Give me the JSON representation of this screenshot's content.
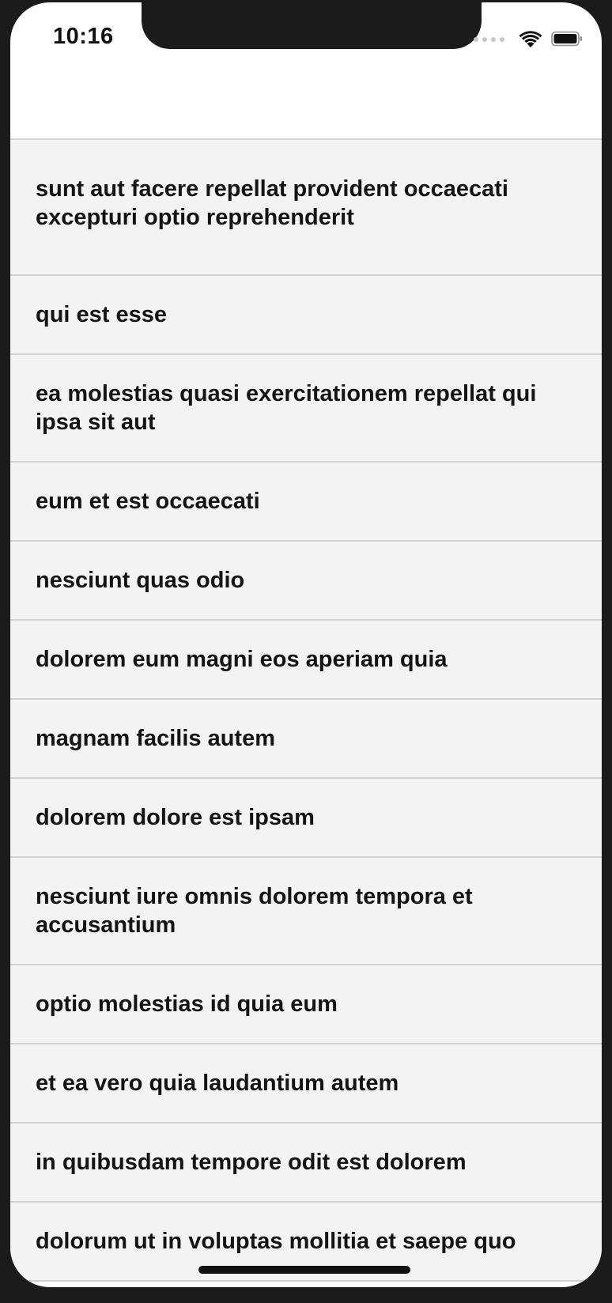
{
  "status_bar": {
    "time": "10:16",
    "icons": [
      "cellular-signal-icon",
      "wifi-icon",
      "battery-icon"
    ]
  },
  "list": {
    "items": [
      "sunt aut facere repellat provident occaecati excepturi optio reprehenderit",
      "qui est esse",
      "ea molestias quasi exercitationem repellat qui ipsa sit aut",
      "eum et est occaecati",
      "nesciunt quas odio",
      "dolorem eum magni eos aperiam quia",
      "magnam facilis autem",
      "dolorem dolore est ipsam",
      "nesciunt iure omnis dolorem tempora et accusantium",
      "optio molestias id quia eum",
      "et ea vero quia laudantium autem",
      "in quibusdam tempore odit est dolorem",
      "dolorum ut in voluptas mollitia et saepe quo"
    ]
  },
  "colors": {
    "list_background": "#f3f3f3",
    "divider": "#d2d2d2",
    "text": "#141414",
    "frame": "#1b1b1b"
  }
}
